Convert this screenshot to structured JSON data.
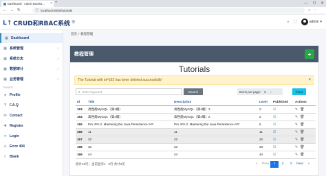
{
  "browser": {
    "tab_title": "Dashboard - Admin Bootstr...",
    "url": "localhost:8000/tutorials",
    "close_glyph": "×",
    "newtab_glyph": "+",
    "win_min": "—",
    "win_max": "☐",
    "win_close": "✕"
  },
  "header": {
    "logo_mark": "L↑",
    "logo_text": "CRUD和RBAC系统",
    "user": "admin",
    "user_chevron": "▾"
  },
  "sidebar": {
    "items": [
      {
        "label": "Dashboard",
        "icon": "grid-icon",
        "glyph": "▦"
      },
      {
        "label": "系统管理",
        "icon": "grid-icon",
        "glyph": "▦",
        "chevron": "›"
      },
      {
        "label": "系统日志",
        "icon": "grid-icon",
        "glyph": "▦",
        "chevron": "›"
      },
      {
        "label": "数据审计",
        "icon": "grid-icon",
        "glyph": "▦",
        "chevron": "›"
      },
      {
        "label": "业务管理",
        "icon": "grid-icon",
        "glyph": "▦",
        "chevron": "›"
      }
    ],
    "section_label": "PAGES",
    "pages": [
      {
        "label": "Profile",
        "icon": "user-icon",
        "glyph": "●"
      },
      {
        "label": "F.A.Q",
        "icon": "help-icon",
        "glyph": "?"
      },
      {
        "label": "Contact",
        "icon": "contact-icon",
        "glyph": "✉"
      },
      {
        "label": "Register",
        "icon": "register-icon",
        "glyph": "✚"
      },
      {
        "label": "Login",
        "icon": "login-icon",
        "glyph": "➔"
      },
      {
        "label": "Error 404",
        "icon": "error-icon",
        "glyph": "⚠"
      },
      {
        "label": "Blank",
        "icon": "blank-icon",
        "glyph": "□"
      }
    ]
  },
  "breadcrumb": {
    "home": "首页",
    "sep": "/",
    "current": "教程管理"
  },
  "card": {
    "title": "教程管理",
    "add_glyph": "+",
    "heading": "Tutorials"
  },
  "alert": {
    "message": "The Tutorial with id=162 has been deleted successfully!",
    "close": "×"
  },
  "search": {
    "placeholder": "Enter keyword",
    "button": "Search",
    "icon": "🔍"
  },
  "per_page": {
    "label": "Items per page:",
    "value": "6",
    "chevron": "⌄"
  },
  "clear_button": "Clear",
  "table": {
    "headers": {
      "id": "Id",
      "title": "Title",
      "description": "Description",
      "level": "Level",
      "published": "Published",
      "actions": "Actions"
    },
    "rows": [
      {
        "id": "163",
        "title": "高性能MySQL（第4版）",
        "description": "高性能MySQL（第4版）2",
        "level": "2"
      },
      {
        "id": "164",
        "title": "高性能MySQL（第4版）",
        "description": "高性能MySQL（第4版）2",
        "level": "2"
      },
      {
        "id": "165",
        "title": "Pro JPA 2: Mastering the Java Persistence API",
        "description": "Pro JPA 2: Mastering the Java Persistence API",
        "level": "6"
      },
      {
        "id": "166",
        "title": "11",
        "description": "11",
        "level": "11"
      },
      {
        "id": "167",
        "title": "22",
        "description": "22",
        "level": "22"
      },
      {
        "id": "168",
        "title": "33",
        "description": "33",
        "level": "33"
      },
      {
        "id": "169",
        "title": "44",
        "description": "44",
        "level": "44"
      }
    ]
  },
  "footer": {
    "info": "统计18行，当前显示1 - 6行 共计3页",
    "pager": {
      "first": "«",
      "prev": "Prev",
      "pages": [
        "1",
        "2",
        "3"
      ],
      "next": "Next",
      "last": "»"
    }
  }
}
